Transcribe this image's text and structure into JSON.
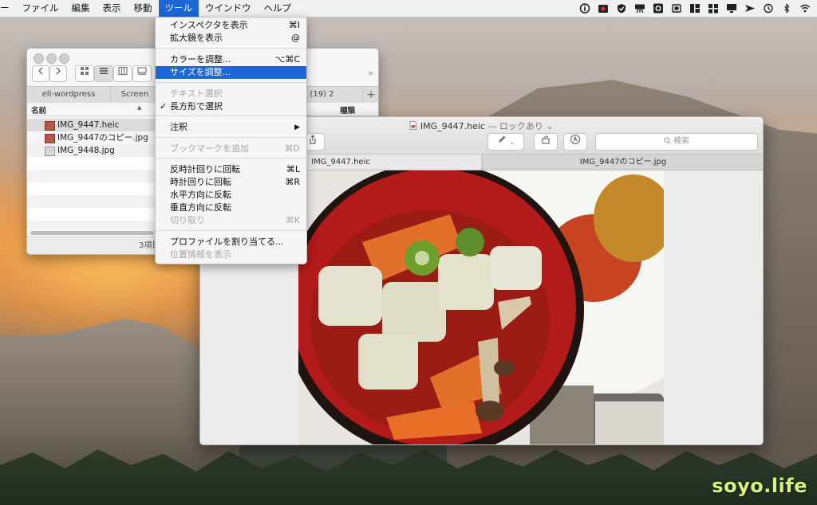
{
  "menubar": {
    "items": [
      {
        "label": "ー",
        "active": false
      },
      {
        "label": "ファイル",
        "active": false
      },
      {
        "label": "編集",
        "active": false
      },
      {
        "label": "表示",
        "active": false
      },
      {
        "label": "移動",
        "active": false
      },
      {
        "label": "ツール",
        "active": true
      },
      {
        "label": "ウインドウ",
        "active": false
      },
      {
        "label": "ヘルプ",
        "active": false
      }
    ],
    "accent": "#1e66d6"
  },
  "tools_menu": {
    "items": [
      {
        "label": "インスペクタを表示",
        "shortcut": "⌘I"
      },
      {
        "label": "拡大鏡を表示",
        "shortcut": "@"
      },
      {
        "label": "カラーを調整...",
        "shortcut": "⌥⌘C"
      },
      {
        "label": "サイズを調整...",
        "shortcut": ""
      },
      {
        "label": "テキスト選択",
        "shortcut": ""
      },
      {
        "label": "長方形で選択",
        "shortcut": "",
        "check": "✓"
      },
      {
        "label": "注釈",
        "shortcut": "",
        "arrow": "▶"
      },
      {
        "label": "ブックマークを追加",
        "shortcut": "⌘D"
      },
      {
        "label": "反時計回りに回転",
        "shortcut": "⌘L"
      },
      {
        "label": "時計回りに回転",
        "shortcut": "⌘R"
      },
      {
        "label": "水平方向に反転",
        "shortcut": ""
      },
      {
        "label": "垂直方向に反転",
        "shortcut": ""
      },
      {
        "label": "切り取り",
        "shortcut": "⌘K"
      },
      {
        "label": "プロファイルを割り当てる...",
        "shortcut": ""
      },
      {
        "label": "位置情報を表示",
        "shortcut": ""
      }
    ]
  },
  "finder": {
    "tabs": [
      "ell-wordpress",
      "Screen",
      "tos (19) 2"
    ],
    "add_tab": "+",
    "overflow": "»",
    "columns": {
      "name": "名前",
      "sort_arrow": "▲",
      "kind": "種類"
    },
    "files": [
      "IMG_9447.heic",
      "IMG_9447のコピー.jpg",
      "IMG_9448.jpg"
    ],
    "status": "3項目"
  },
  "preview": {
    "filename": "IMG_9447.heic",
    "lock_status": "— ロックあり ⌄",
    "search_placeholder": "検索",
    "tabs": [
      "IMG_9447.heic",
      "IMG_9447のコピー.jpg"
    ]
  },
  "watermark": "soyo.life"
}
